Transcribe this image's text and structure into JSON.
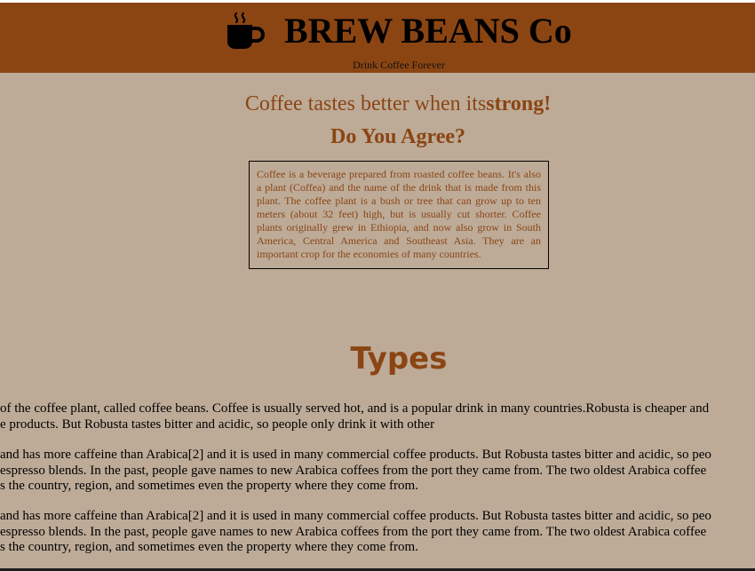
{
  "header": {
    "brand_title": "BREW BEANS Co",
    "tagline": "Drink Coffee Forever",
    "logo_icon": "coffee-cup-icon"
  },
  "main": {
    "headline_prefix": "Coffee tastes better when its",
    "headline_strong": "strong!",
    "question": "Do You Agree?",
    "info_text": "Coffee is a beverage prepared from roasted coffee beans. It's also a plant (Coffea) and the name of the drink that is made from this plant. The coffee plant is a bush or tree that can grow up to ten meters (about 32 feet) high, but is usually cut shorter. Coffee plants originally grew in Ethiopia, and now also grow in South America, Central America and Southeast Asia. They are an important crop for the economies of many countries."
  },
  "types": {
    "heading": "Types",
    "paragraphs": [
      {
        "lines": [
          "of the coffee plant, called coffee beans. Coffee is usually served hot, and is a popular drink in many countries.Robusta is cheaper and",
          "e products. But Robusta tastes bitter and acidic, so people only drink it with other"
        ]
      },
      {
        "lines": [
          "and has more caffeine than Arabica[2] and it is used in many commercial coffee products. But Robusta tastes bitter and acidic, so peo",
          "espresso blends. In the past, people gave names to new Arabica coffees from the port they came from. The two oldest Arabica coffee",
          "s the country, region, and sometimes even the property where they come from."
        ]
      },
      {
        "lines": [
          "and has more caffeine than Arabica[2] and it is used in many commercial coffee products. But Robusta tastes bitter and acidic, so peo",
          "espresso blends. In the past, people gave names to new Arabica coffees from the port they came from. The two oldest Arabica coffee",
          "s the country, region, and sometimes even the property where they come from."
        ]
      }
    ]
  },
  "colors": {
    "page_background": "#bdab98",
    "header_background": "#8b4513",
    "accent_text": "#8b4513"
  }
}
